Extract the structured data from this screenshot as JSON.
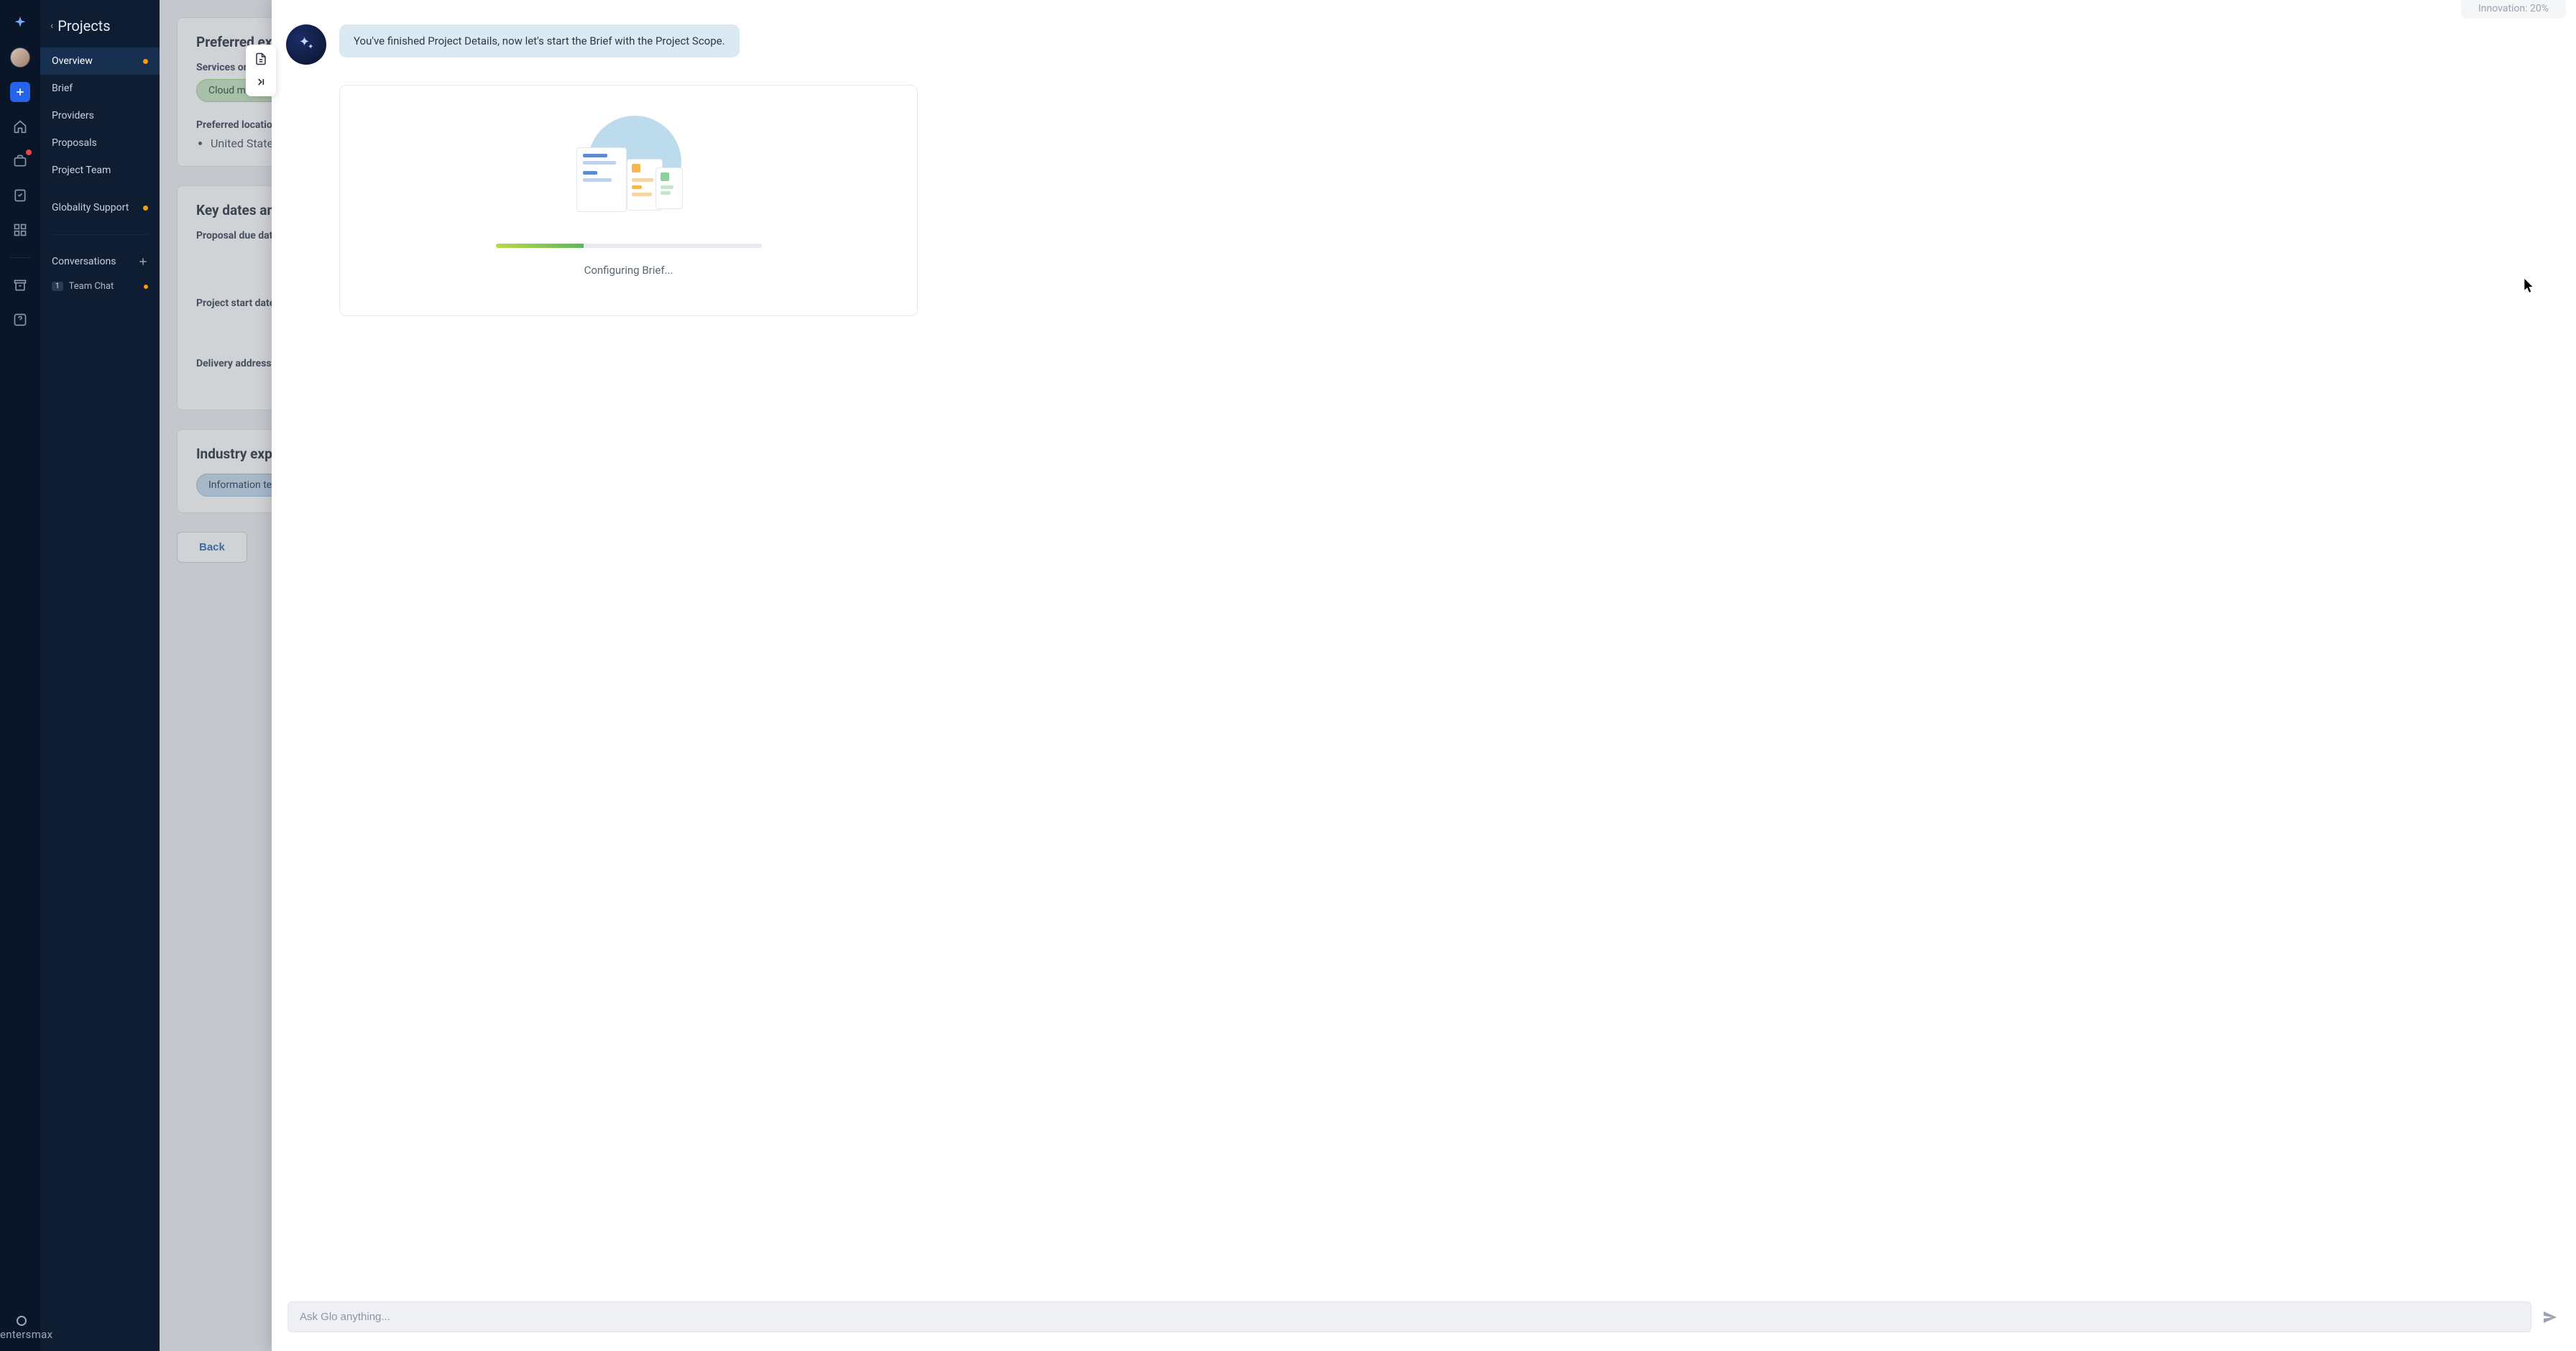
{
  "brand": "entersmax",
  "sidebar": {
    "title": "Projects",
    "items": [
      {
        "label": "Overview",
        "active": true,
        "dot": true
      },
      {
        "label": "Brief"
      },
      {
        "label": "Providers"
      },
      {
        "label": "Proposals"
      },
      {
        "label": "Project Team"
      },
      {
        "label": "Globality Support",
        "dot": true
      }
    ],
    "conversations_label": "Conversations",
    "team_chat": {
      "badge": "1",
      "label": "Team Chat",
      "dot": true
    }
  },
  "content": {
    "card1": {
      "title": "Preferred expertise",
      "services_label": "Services or products",
      "service_chip": "Cloud migration",
      "location_label": "Preferred location",
      "location_value": "United States"
    },
    "card2": {
      "title": "Key dates and locations",
      "f1": "Proposal due date",
      "f2": "Project start date",
      "f3": "Delivery address"
    },
    "card3": {
      "title": "Industry expertise",
      "chip": "Information technology"
    },
    "back_label": "Back"
  },
  "assistant": {
    "message": "You've finished Project Details, now let's start the Brief with the Project Scope.",
    "loading_text": "Configuring Brief...",
    "top_chip": "Innovation: 20%",
    "input_placeholder": "Ask Glo anything..."
  }
}
